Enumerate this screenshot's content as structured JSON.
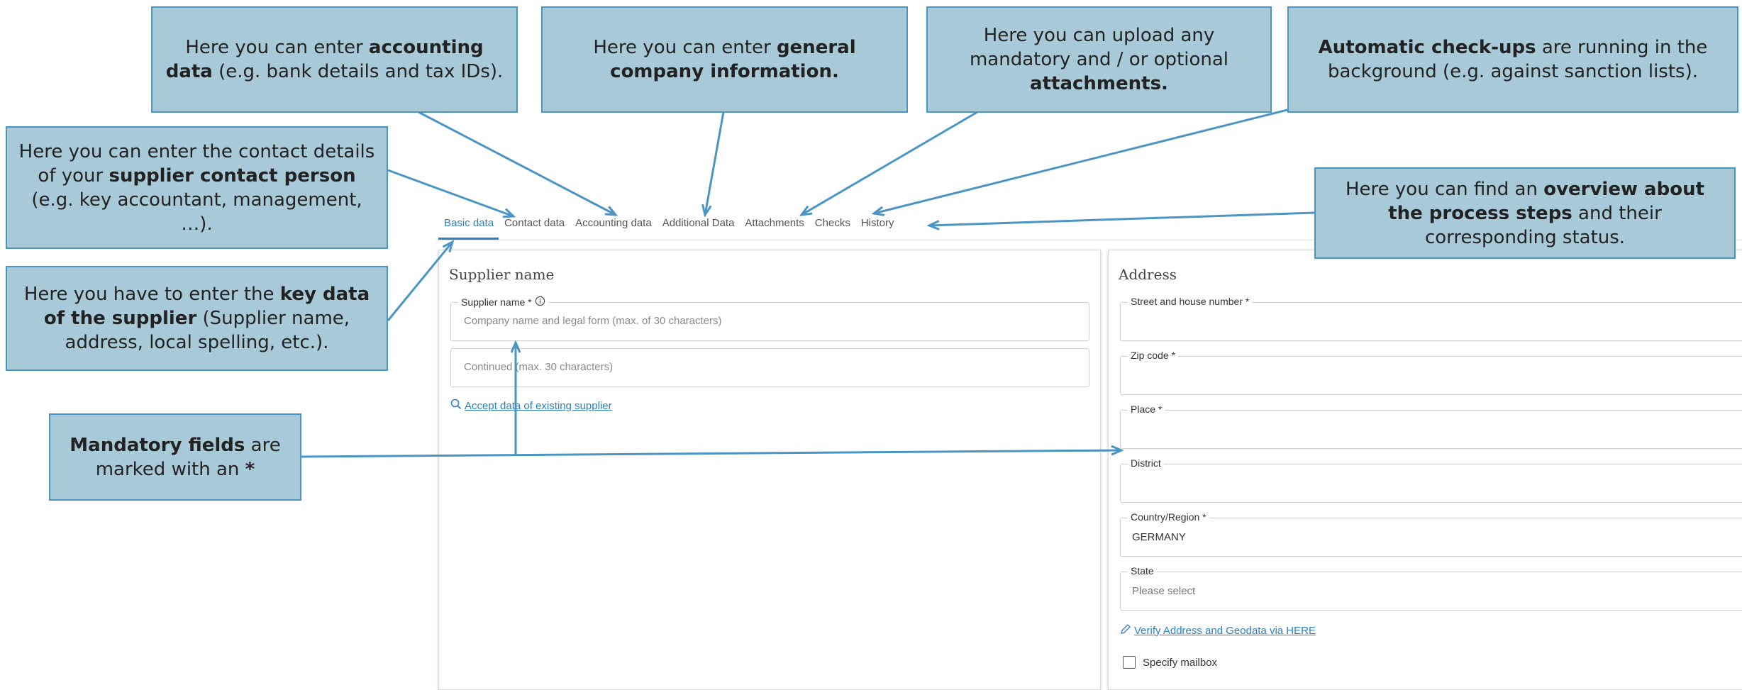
{
  "tabs": [
    {
      "label": "Basic data",
      "active": true
    },
    {
      "label": "Contact data",
      "active": false
    },
    {
      "label": "Accounting data",
      "active": false
    },
    {
      "label": "Additional Data",
      "active": false
    },
    {
      "label": "Attachments",
      "active": false
    },
    {
      "label": "Checks",
      "active": false
    },
    {
      "label": "History",
      "active": false
    }
  ],
  "supplier_panel": {
    "title": "Supplier name",
    "supplier_name_label": "Supplier name *",
    "supplier_name_placeholder": "Company name and legal form (max. of 30 characters)",
    "continued_placeholder": "Continued (max. 30 characters)",
    "accept_link": "Accept data of existing supplier"
  },
  "address_panel": {
    "title": "Address",
    "street_label": "Street and house number *",
    "zip_label": "Zip code *",
    "place_label": "Place *",
    "district_label": "District",
    "country_label": "Country/Region *",
    "country_value": "GERMANY",
    "state_label": "State",
    "state_value": "Please select",
    "verify_link": "Verify Address and Geodata via HERE",
    "mailbox_label": "Specify mailbox"
  },
  "callouts": {
    "accounting": {
      "pre": "Here you can enter ",
      "bold": "accounting data",
      "post": " (e.g. bank details and tax IDs)."
    },
    "general": {
      "pre": "Here you can enter ",
      "bold": "general company information.",
      "post": ""
    },
    "attachments": {
      "pre": "Here you can upload any mandatory and / or optional ",
      "bold": "attachments.",
      "post": ""
    },
    "checks": {
      "pre": "",
      "bold": "Automatic check-ups",
      "post": " are running in the background (e.g. against sanction lists)."
    },
    "contact": {
      "pre": "Here you can enter the contact details of your ",
      "bold": "supplier contact person",
      "post": " (e.g. key accountant, management, …)."
    },
    "key_data": {
      "pre": "Here you have to enter the ",
      "bold": "key data of the supplier",
      "post": " (Supplier name, address, local spelling, etc.)."
    },
    "history": {
      "pre": "Here you can find an ",
      "bold": "overview about the process steps",
      "post": " and their corresponding status."
    },
    "mandatory": {
      "pre": "",
      "bold": "Mandatory fields",
      "post": " are marked with an ",
      "bold2": "*"
    }
  },
  "colors": {
    "accent": "#2d7fc1",
    "callout_fill": "#a8cad8",
    "callout_border": "#4a95c4",
    "arrow": "#4a95c4"
  }
}
